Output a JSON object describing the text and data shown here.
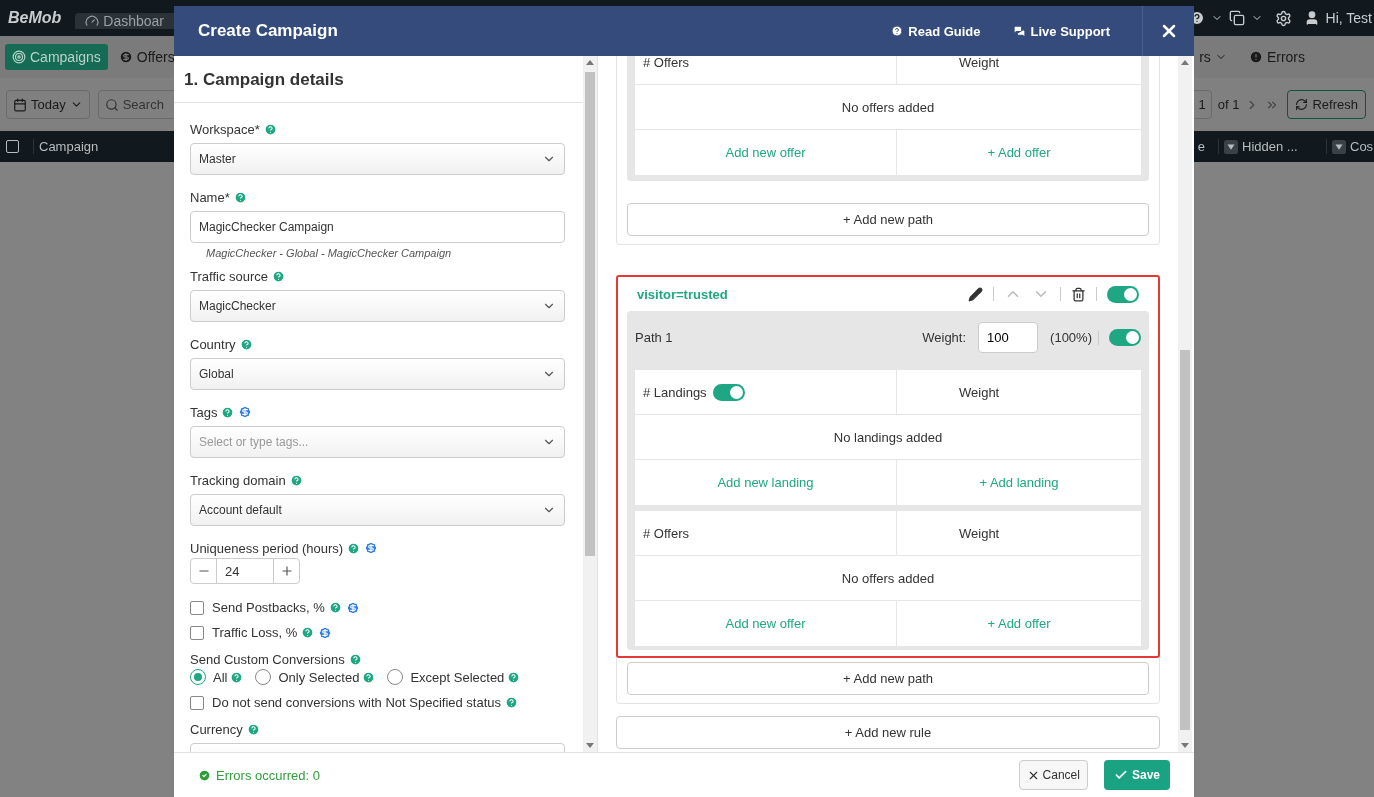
{
  "app": {
    "logo": "BeMob",
    "tab": "Dashboar",
    "user": "Hi, Test",
    "nav": [
      {
        "label": "Campaigns",
        "selected": true
      },
      {
        "label": "Offers",
        "selected": false
      }
    ],
    "nav_right": [
      {
        "label": "rs",
        "kind": "dropdown"
      },
      {
        "label": "Errors",
        "kind": "alert"
      }
    ],
    "date": "Today",
    "search_placeholder": "Search",
    "page": "1",
    "page_total": "of 1",
    "refresh": "Refresh",
    "all_selected": false,
    "columns": [
      {
        "label": "Campaign",
        "filter": false
      }
    ],
    "right_columns": [
      {
        "label": "e",
        "filter": false
      },
      {
        "label": "Hidden ...",
        "filter": true
      },
      {
        "label": "Cos",
        "filter": true
      }
    ]
  },
  "modal": {
    "title": "Create Campaign",
    "links": [
      {
        "label": "Read Guide",
        "kind": "guide"
      },
      {
        "label": "Live Support",
        "kind": "chat"
      }
    ],
    "section_title": "1. Campaign details",
    "fields": [
      {
        "kind": "select",
        "label": "Workspace*",
        "premium": false,
        "value": "Master"
      },
      {
        "kind": "text",
        "label": "Name*",
        "premium": false,
        "value": "MagicChecker Campaign",
        "hint": "MagicChecker - Global - MagicChecker Campaign"
      },
      {
        "kind": "select",
        "label": "Traffic source",
        "premium": false,
        "value": "MagicChecker"
      },
      {
        "kind": "select",
        "label": "Country",
        "premium": false,
        "value": "Global"
      },
      {
        "kind": "select",
        "label": "Tags",
        "premium": true,
        "placeholder": "Select or type tags..."
      },
      {
        "kind": "select",
        "label": "Tracking domain",
        "premium": false,
        "value": "Account default"
      },
      {
        "kind": "stepper",
        "label": "Uniqueness period (hours)",
        "premium": true,
        "value": "24"
      },
      {
        "kind": "checkbox",
        "label": "Send Postbacks, %",
        "premium": true,
        "checked": false
      },
      {
        "kind": "checkbox",
        "label": "Traffic Loss, %",
        "premium": true,
        "checked": false
      },
      {
        "kind": "radio",
        "label": "Send Custom Conversions",
        "premium": false,
        "options": [
          {
            "label": "All",
            "selected": true
          },
          {
            "label": "Only Selected",
            "selected": false
          },
          {
            "label": "Except Selected",
            "selected": false
          }
        ]
      },
      {
        "kind": "checkbox",
        "label": "Do not send conversions with Not Specified status",
        "premium": false,
        "checked": false
      },
      {
        "kind": "select",
        "label": "Currency",
        "premium": false
      }
    ],
    "rules": [
      {
        "highlighted": false,
        "paths": [
          {
            "tables": [
              {
                "header": "# Offers",
                "weight": "Weight",
                "empty": "No offers added",
                "add_new": "Add new offer",
                "add": "+ Add offer"
              }
            ]
          }
        ],
        "add_path": "+ Add new path"
      },
      {
        "condition": "visitor=trusted",
        "highlighted": true,
        "on": true,
        "paths": [
          {
            "name": "Path 1",
            "weight_label": "Weight:",
            "weight": "100",
            "share": "(100%)",
            "on": true,
            "tables": [
              {
                "header": "# Landings",
                "on": true,
                "weight": "Weight",
                "empty": "No landings added",
                "add_new": "Add new landing",
                "add": "+ Add landing"
              },
              {
                "header": "# Offers",
                "weight": "Weight",
                "empty": "No offers added",
                "add_new": "Add new offer",
                "add": "+ Add offer"
              }
            ]
          }
        ],
        "add_path": "+ Add new path"
      }
    ],
    "add_rule": "+ Add new rule",
    "status": "Errors occurred: 0",
    "cancel": "Cancel",
    "save": "Save"
  }
}
